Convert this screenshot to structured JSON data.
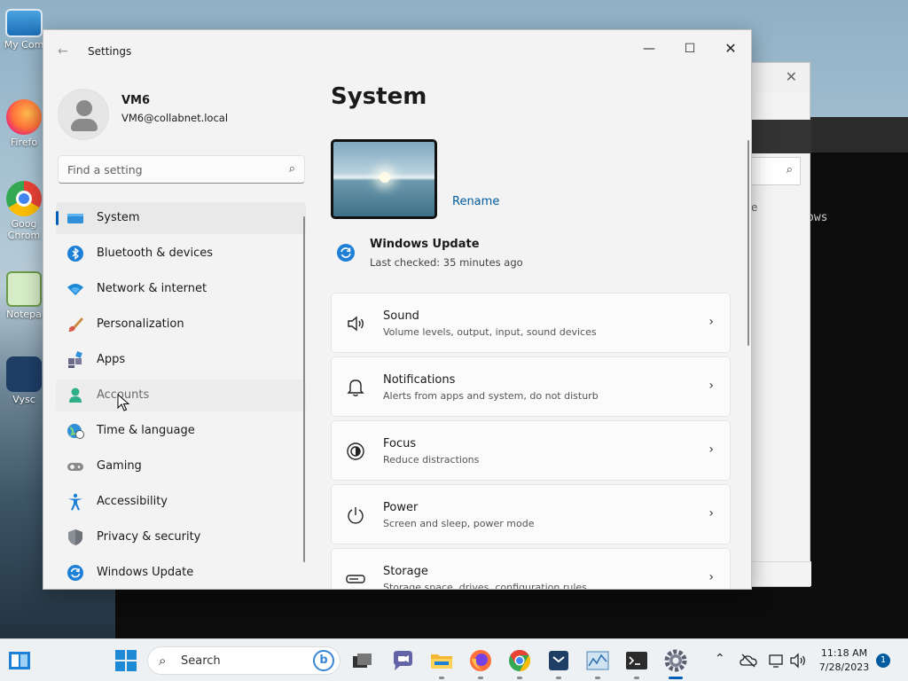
{
  "desktop": {
    "icons": [
      {
        "label": "My Com"
      },
      {
        "label": "Firefo"
      },
      {
        "label": "Goog Chrom"
      },
      {
        "label": "Notepa"
      },
      {
        "label": "Vysc"
      }
    ]
  },
  "background_window": {
    "terminal_text": "ows",
    "partial_text": "e"
  },
  "window": {
    "title": "Settings",
    "back_icon": "back-arrow-icon",
    "controls": {
      "minimize": "—",
      "maximize": "☐",
      "close": "✕"
    }
  },
  "profile": {
    "name": "VM6",
    "email": "VM6@collabnet.local"
  },
  "search": {
    "placeholder": "Find a setting",
    "icon": "search-icon"
  },
  "nav": {
    "items": [
      {
        "label": "System",
        "icon": "system-icon",
        "active": true
      },
      {
        "label": "Bluetooth & devices",
        "icon": "bluetooth-icon"
      },
      {
        "label": "Network & internet",
        "icon": "wifi-icon"
      },
      {
        "label": "Personalization",
        "icon": "brush-icon"
      },
      {
        "label": "Apps",
        "icon": "apps-icon"
      },
      {
        "label": "Accounts",
        "icon": "accounts-icon",
        "hover": true
      },
      {
        "label": "Time & language",
        "icon": "globe-clock-icon"
      },
      {
        "label": "Gaming",
        "icon": "gamepad-icon"
      },
      {
        "label": "Accessibility",
        "icon": "accessibility-icon"
      },
      {
        "label": "Privacy & security",
        "icon": "shield-icon"
      },
      {
        "label": "Windows Update",
        "icon": "update-icon"
      }
    ]
  },
  "main": {
    "title": "System",
    "rename": "Rename",
    "windows_update": {
      "title": "Windows Update",
      "subtitle": "Last checked: 35 minutes ago"
    },
    "cards": [
      {
        "title": "Sound",
        "subtitle": "Volume levels, output, input, sound devices",
        "icon": "speaker-icon"
      },
      {
        "title": "Notifications",
        "subtitle": "Alerts from apps and system, do not disturb",
        "icon": "bell-icon"
      },
      {
        "title": "Focus",
        "subtitle": "Reduce distractions",
        "icon": "focus-icon"
      },
      {
        "title": "Power",
        "subtitle": "Screen and sleep, power mode",
        "icon": "power-icon"
      },
      {
        "title": "Storage",
        "subtitle": "Storage space, drives, configuration rules",
        "icon": "storage-icon"
      }
    ]
  },
  "taskbar": {
    "search_label": "Search",
    "time": "11:18 AM",
    "date": "7/28/2023",
    "notification_count": "1"
  },
  "colors": {
    "accent": "#005fb8",
    "link": "#005a9e"
  }
}
